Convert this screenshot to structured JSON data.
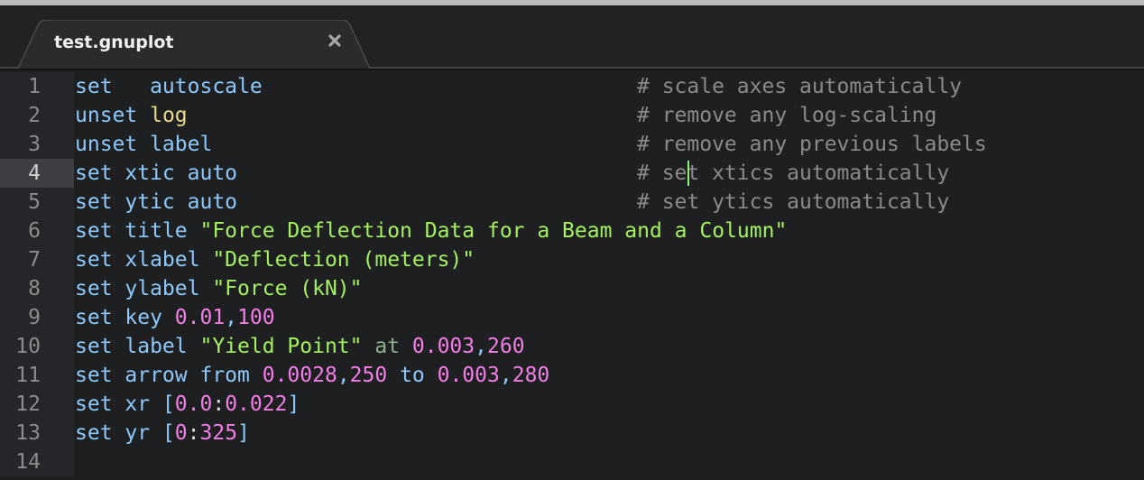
{
  "window": {
    "top_strip": ""
  },
  "tabs": [
    {
      "title": "test.gnuplot",
      "close_icon": "close-icon",
      "active": true
    }
  ],
  "editor": {
    "active_line": 4,
    "caret": {
      "line": 4,
      "column_in_comment": 4
    },
    "colors": {
      "keyword": "#8ec8fa",
      "function": "#e7d88a",
      "string": "#a5f05f",
      "number": "#f37ee8",
      "comment": "#8a8a8a",
      "caret": "#8ff07a"
    },
    "lines": [
      {
        "number": "1",
        "tokens": [
          [
            "kw",
            "set   autoscale"
          ]
        ],
        "comment": "# scale axes automatically"
      },
      {
        "number": "2",
        "tokens": [
          [
            "kw",
            "unset "
          ],
          [
            "fn",
            "log"
          ]
        ],
        "comment": "# remove any log-scaling"
      },
      {
        "number": "3",
        "tokens": [
          [
            "kw",
            "unset label"
          ]
        ],
        "comment": "# remove any previous labels"
      },
      {
        "number": "4",
        "tokens": [
          [
            "kw",
            "set xtic auto"
          ]
        ],
        "comment": "# set xtics automatically"
      },
      {
        "number": "5",
        "tokens": [
          [
            "kw",
            "set ytic auto"
          ]
        ],
        "comment": "# set ytics automatically"
      },
      {
        "number": "6",
        "tokens": [
          [
            "kw",
            "set title "
          ],
          [
            "str",
            "\"Force Deflection Data for a Beam and a Column\""
          ]
        ],
        "comment": ""
      },
      {
        "number": "7",
        "tokens": [
          [
            "kw",
            "set xlabel "
          ],
          [
            "str",
            "\"Deflection (meters)\""
          ]
        ],
        "comment": ""
      },
      {
        "number": "8",
        "tokens": [
          [
            "kw",
            "set ylabel "
          ],
          [
            "str",
            "\"Force (kN)\""
          ]
        ],
        "comment": ""
      },
      {
        "number": "9",
        "tokens": [
          [
            "kw",
            "set key "
          ],
          [
            "num",
            "0.01"
          ],
          [
            "kw",
            ","
          ],
          [
            "num",
            "100"
          ]
        ],
        "comment": ""
      },
      {
        "number": "10",
        "tokens": [
          [
            "kw",
            "set label "
          ],
          [
            "str",
            "\"Yield Point\""
          ],
          [
            "op",
            " at "
          ],
          [
            "num",
            "0.003"
          ],
          [
            "kw",
            ","
          ],
          [
            "num",
            "260"
          ]
        ],
        "comment": ""
      },
      {
        "number": "11",
        "tokens": [
          [
            "kw",
            "set arrow from "
          ],
          [
            "num",
            "0.0028"
          ],
          [
            "kw",
            ","
          ],
          [
            "num",
            "250"
          ],
          [
            "kw",
            " to "
          ],
          [
            "num",
            "0.003"
          ],
          [
            "kw",
            ","
          ],
          [
            "num",
            "280"
          ]
        ],
        "comment": ""
      },
      {
        "number": "12",
        "tokens": [
          [
            "kw",
            "set xr ["
          ],
          [
            "num",
            "0.0"
          ],
          [
            "punc",
            ":"
          ],
          [
            "num",
            "0.022"
          ],
          [
            "kw",
            "]"
          ]
        ],
        "comment": ""
      },
      {
        "number": "13",
        "tokens": [
          [
            "kw",
            "set yr ["
          ],
          [
            "num",
            "0"
          ],
          [
            "punc",
            ":"
          ],
          [
            "num",
            "325"
          ],
          [
            "kw",
            "]"
          ]
        ],
        "comment": ""
      },
      {
        "number": "14",
        "tokens": [],
        "comment": ""
      }
    ]
  }
}
